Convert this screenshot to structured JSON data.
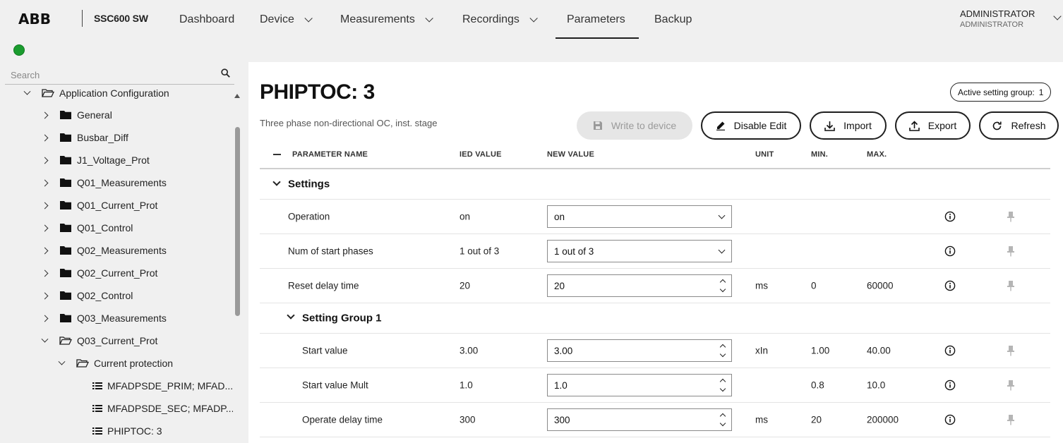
{
  "header": {
    "logo": "ABB",
    "product": "SSC600 SW",
    "nav": [
      {
        "label": "Dashboard",
        "has_menu": false
      },
      {
        "label": "Device",
        "has_menu": true
      },
      {
        "label": "Measurements",
        "has_menu": true
      },
      {
        "label": "Recordings",
        "has_menu": true
      },
      {
        "label": "Parameters",
        "has_menu": false,
        "active": true
      },
      {
        "label": "Backup",
        "has_menu": false
      }
    ],
    "user": {
      "name": "ADMINISTRATOR",
      "role": "ADMINISTRATOR"
    }
  },
  "sidebar": {
    "status_color": "#1a9c2e",
    "search_placeholder": "Search",
    "tree": [
      {
        "label": "Application Configuration",
        "expanded": true,
        "icon": "folder-open-icon"
      },
      {
        "label": "General",
        "expanded": false,
        "icon": "folder-icon"
      },
      {
        "label": "Busbar_Diff",
        "expanded": false,
        "icon": "folder-icon"
      },
      {
        "label": "J1_Voltage_Prot",
        "expanded": false,
        "icon": "folder-icon"
      },
      {
        "label": "Q01_Measurements",
        "expanded": false,
        "icon": "folder-icon"
      },
      {
        "label": "Q01_Current_Prot",
        "expanded": false,
        "icon": "folder-icon"
      },
      {
        "label": "Q01_Control",
        "expanded": false,
        "icon": "folder-icon"
      },
      {
        "label": "Q02_Measurements",
        "expanded": false,
        "icon": "folder-icon"
      },
      {
        "label": "Q02_Current_Prot",
        "expanded": false,
        "icon": "folder-icon"
      },
      {
        "label": "Q02_Control",
        "expanded": false,
        "icon": "folder-icon"
      },
      {
        "label": "Q03_Measurements",
        "expanded": false,
        "icon": "folder-icon"
      },
      {
        "label": "Q03_Current_Prot",
        "expanded": true,
        "icon": "folder-open-icon"
      },
      {
        "label": "Current protection",
        "expanded": true,
        "icon": "folder-open-icon"
      },
      {
        "label": "MFADPSDE_PRIM; MFAD...",
        "icon": "list-icon"
      },
      {
        "label": "MFADPSDE_SEC; MFADP...",
        "icon": "list-icon"
      },
      {
        "label": "PHIPTOC: 3",
        "icon": "list-icon"
      }
    ]
  },
  "main": {
    "title": "PHIPTOC: 3",
    "subtitle": "Three phase non-directional OC, inst. stage",
    "active_setting_group_label": "Active setting group:",
    "active_setting_group_value": "1",
    "buttons": {
      "write": "Write to device",
      "disable_edit": "Disable Edit",
      "import": "Import",
      "export": "Export",
      "refresh": "Refresh"
    },
    "columns": {
      "name": "PARAMETER NAME",
      "ied": "IED VALUE",
      "new": "NEW VALUE",
      "unit": "UNIT",
      "min": "MIN.",
      "max": "MAX."
    },
    "groups": {
      "settings": "Settings",
      "setting_group_1": "Setting Group 1"
    },
    "rows": [
      {
        "name": "Operation",
        "ied": "on",
        "new": "on",
        "control": "select",
        "unit": "",
        "min": "",
        "max": ""
      },
      {
        "name": "Num of start phases",
        "ied": "1 out of 3",
        "new": "1 out of 3",
        "control": "select",
        "unit": "",
        "min": "",
        "max": ""
      },
      {
        "name": "Reset delay time",
        "ied": "20",
        "new": "20",
        "control": "number",
        "unit": "ms",
        "min": "0",
        "max": "60000"
      },
      {
        "name": "Start value",
        "ied": "3.00",
        "new": "3.00",
        "control": "number",
        "unit": "xIn",
        "min": "1.00",
        "max": "40.00"
      },
      {
        "name": "Start value Mult",
        "ied": "1.0",
        "new": "1.0",
        "control": "number",
        "unit": "",
        "min": "0.8",
        "max": "10.0"
      },
      {
        "name": "Operate delay time",
        "ied": "300",
        "new": "300",
        "control": "number",
        "unit": "ms",
        "min": "20",
        "max": "200000"
      }
    ]
  }
}
